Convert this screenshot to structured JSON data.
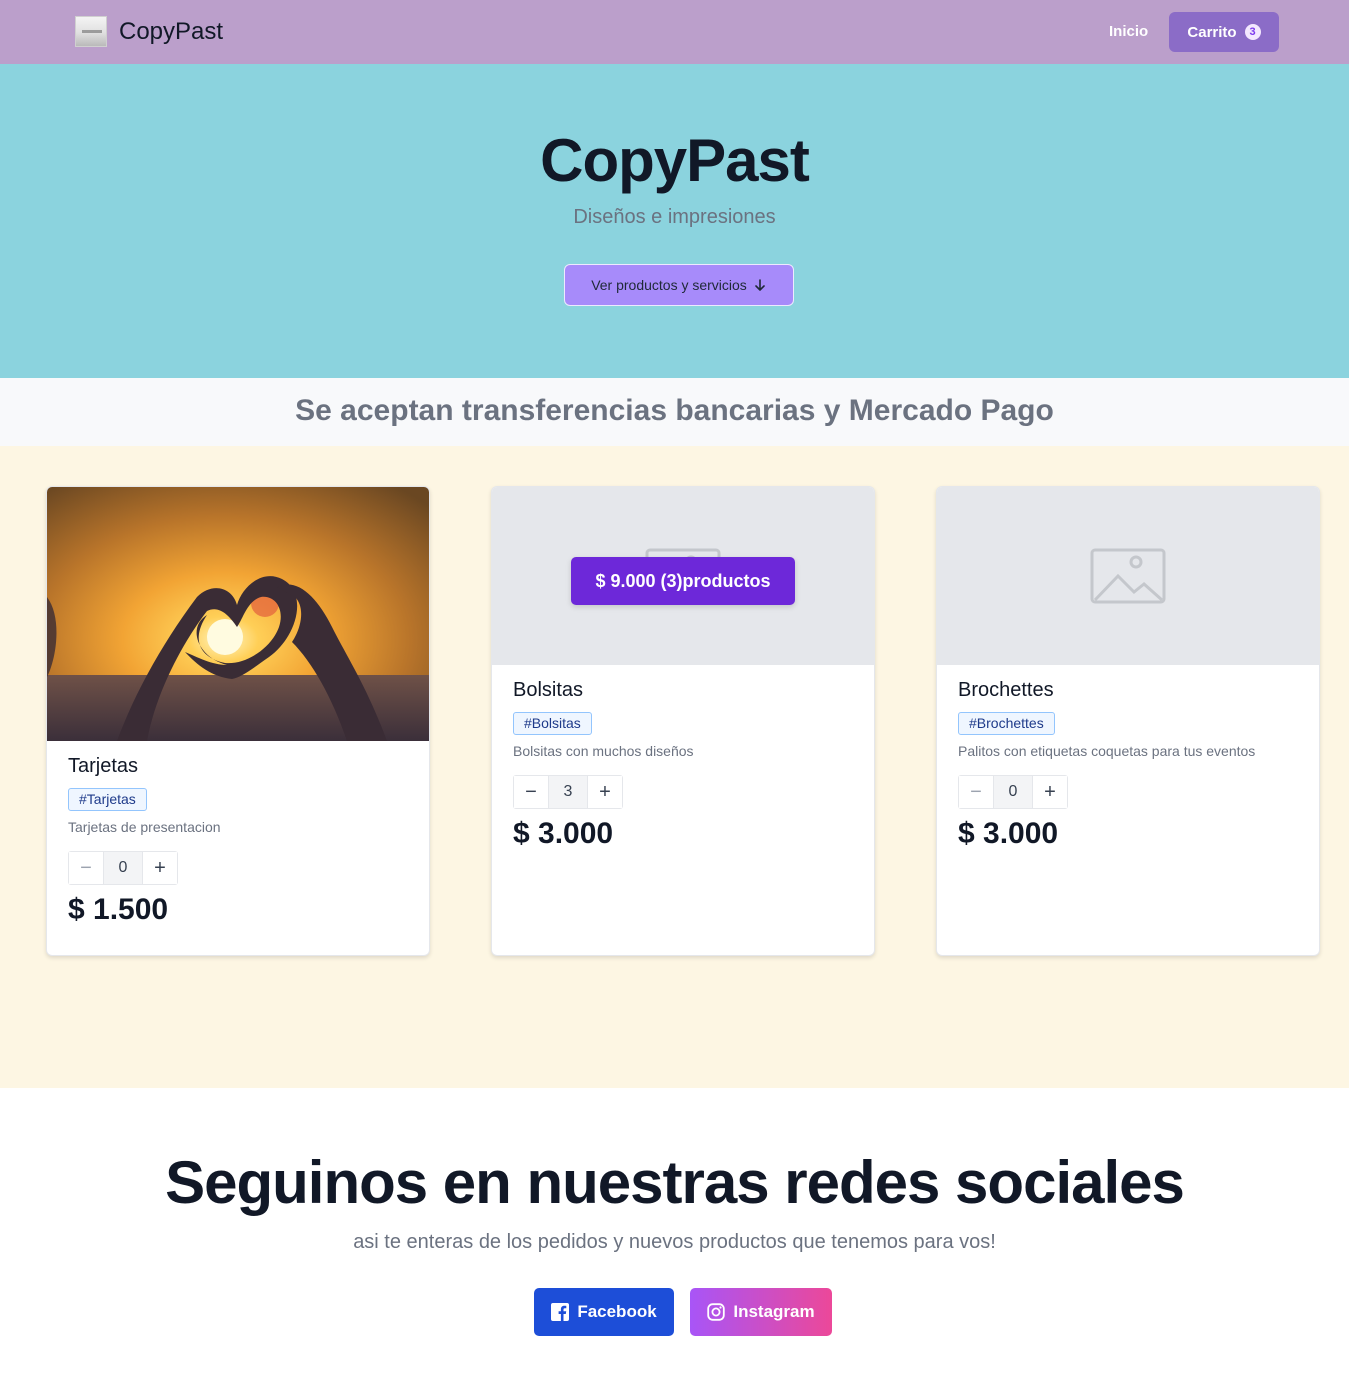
{
  "navbar": {
    "brand": "CopyPast",
    "links": {
      "home": "Inicio",
      "cart": "Carrito"
    },
    "cart_count": "3",
    "background": "#bb9fcb"
  },
  "hero": {
    "title": "CopyPast",
    "subtitle": "Diseños e impresiones",
    "cta": "Ver productos y servicios",
    "cta_icon": "arrow-down-icon",
    "background": "#8bd3de"
  },
  "payment": {
    "text": "Se aceptan transferencias bancarias y Mercado Pago"
  },
  "cart_summary": {
    "text": "$ 9.000 (3)productos"
  },
  "products": [
    {
      "title": "Tarjetas",
      "tag": "#Tarjetas",
      "description": "Tarjetas de presentacion",
      "quantity": "0",
      "price": "$ 1.500",
      "image": "sunset-heart-hands-photo"
    },
    {
      "title": "Bolsitas",
      "tag": "#Bolsitas",
      "description": "Bolsitas con muchos diseños",
      "quantity": "3",
      "price": "$ 3.000",
      "image": "image-placeholder-icon"
    },
    {
      "title": "Brochettes",
      "tag": "#Brochettes",
      "description": "Palitos con etiquetas coquetas para tus eventos",
      "quantity": "0",
      "price": "$ 3.000",
      "image": "image-placeholder-icon"
    }
  ],
  "social": {
    "title": "Seguinos en nuestras redes sociales",
    "subtitle": "asi te enteras de los pedidos y nuevos productos que tenemos para vos!",
    "facebook": "Facebook",
    "instagram": "Instagram"
  },
  "colors": {
    "accent": "#6d28d9",
    "products_bg": "#fdf6e3",
    "facebook": "#1d4ed8"
  }
}
